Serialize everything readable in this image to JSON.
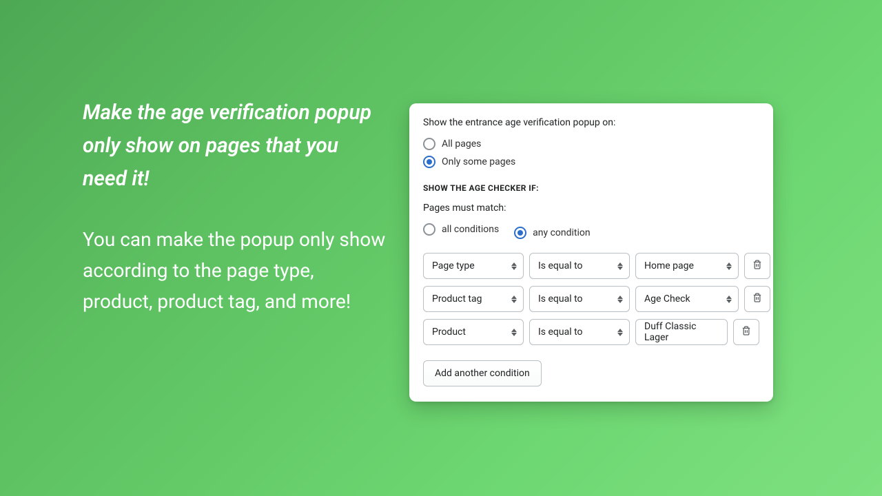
{
  "promo": {
    "headline": "Make the age verification popup only show on pages that you need it!",
    "body": "You can make the popup only show according to the page type, product, product tag, and more!"
  },
  "card": {
    "showOnLabel": "Show the entrance age verification popup on:",
    "showOn": {
      "all": "All pages",
      "some": "Only some pages",
      "selected": "some"
    },
    "sectionHeading": "SHOW THE AGE CHECKER IF:",
    "matchLabel": "Pages must match:",
    "match": {
      "all": "all conditions",
      "any": "any condition",
      "selected": "any"
    },
    "conditions": [
      {
        "field": "Page type",
        "operator": "Is equal to",
        "value": "Home page",
        "valueKind": "select"
      },
      {
        "field": "Product tag",
        "operator": "Is equal to",
        "value": "Age Check",
        "valueKind": "select"
      },
      {
        "field": "Product",
        "operator": "Is equal to",
        "value": "Duff Classic Lager",
        "valueKind": "text"
      }
    ],
    "addButton": "Add another condition"
  },
  "colors": {
    "accent": "#2c6ecb",
    "bgFrom": "#4ea854",
    "bgTo": "#7ee080"
  }
}
